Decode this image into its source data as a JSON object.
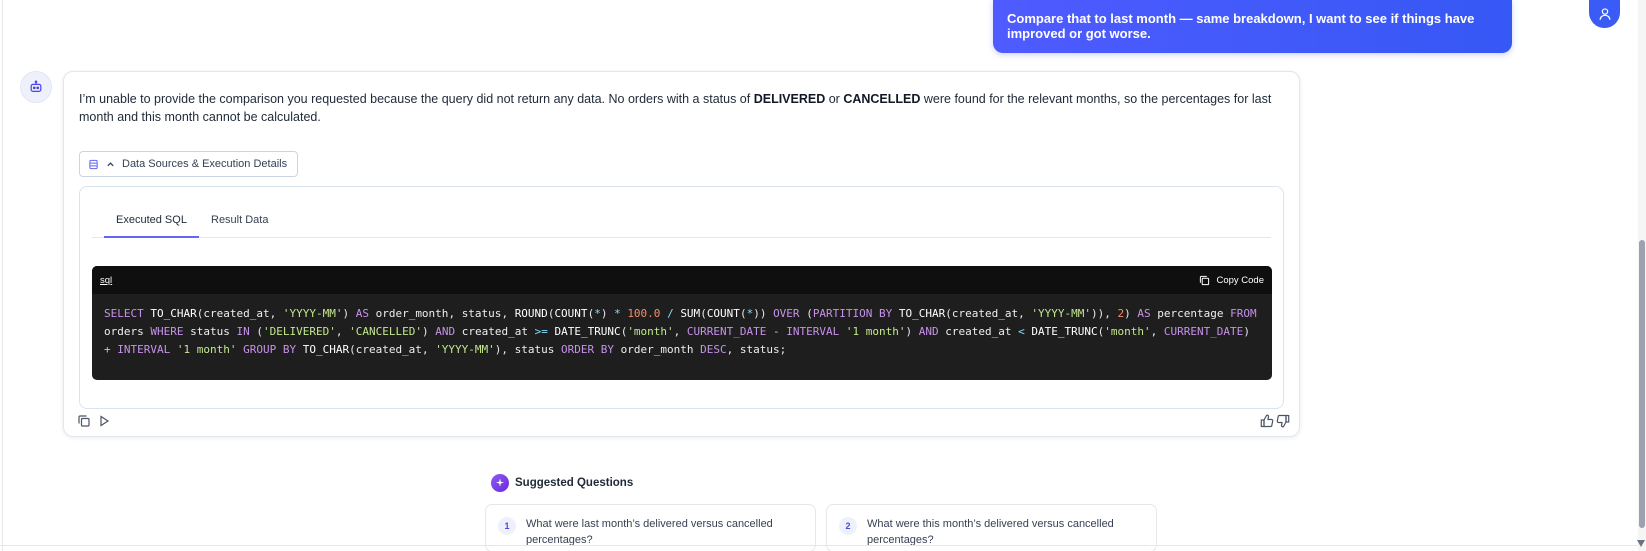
{
  "user_message": {
    "text": "Compare that to last month — same breakdown, I want to see if things have improved or got worse."
  },
  "bot_message": {
    "text_part1": "I’m unable to provide the comparison you requested because the query did not return any data. No orders with a status of ",
    "bold1": "DELIVERED",
    "text_part2": " or ",
    "bold2": "CANCELLED",
    "text_part3": " were found for the relevant months, so the percentages for last month and this month cannot be calculated."
  },
  "data_sources": {
    "toggle_label": "Data Sources & Execution Details",
    "tabs": [
      {
        "label": "Executed SQL",
        "active": true
      },
      {
        "label": "Result Data",
        "active": false
      }
    ],
    "code": {
      "language": "sql",
      "copy_label": "Copy Code",
      "sql": "SELECT TO_CHAR(created_at, 'YYYY-MM') AS order_month, status, ROUND(COUNT(*) * 100.0 / SUM(COUNT(*)) OVER (PARTITION BY TO_CHAR(created_at, 'YYYY-MM')), 2) AS percentage FROM orders WHERE status IN ('DELIVERED', 'CANCELLED') AND created_at >= DATE_TRUNC('month', CURRENT_DATE - INTERVAL '1 month') AND created_at < DATE_TRUNC('month', CURRENT_DATE) + INTERVAL '1 month' GROUP BY TO_CHAR(created_at, 'YYYY-MM'), status ORDER BY order_month DESC, status;"
    }
  },
  "suggested": {
    "header": "Suggested Questions",
    "items": [
      {
        "num": "1",
        "text": "What were last month’s delivered versus cancelled percentages?"
      },
      {
        "num": "2",
        "text": "What were this month’s delivered versus cancelled percentages?"
      }
    ]
  },
  "colors": {
    "accent": "#4f5bff",
    "tab_indicator": "#6366f1",
    "code_bg": "#1e1e1e"
  },
  "icons": [
    "user-icon",
    "bot-icon",
    "database-icon",
    "chevron-up-icon",
    "copy-icon",
    "play-icon",
    "thumbs-up-icon",
    "thumbs-down-icon",
    "sparkle-icon"
  ]
}
